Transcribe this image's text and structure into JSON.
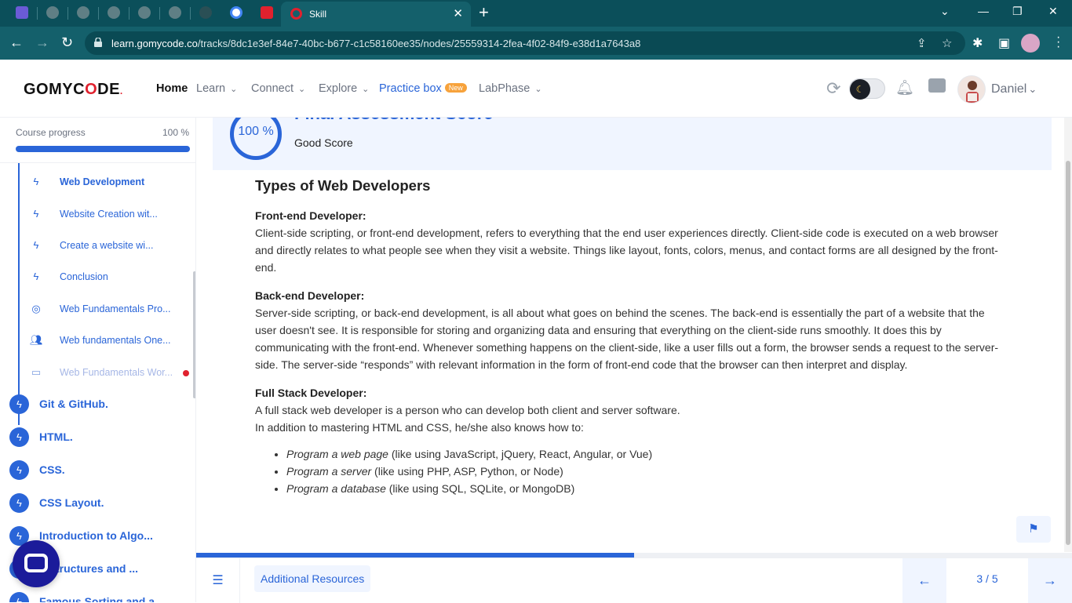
{
  "browser": {
    "active_tab_title": "Skill",
    "url_domain": "learn.gomycode.co",
    "url_path": "/tracks/8dc1e3ef-84e7-40bc-b677-c1c58160ee35/nodes/25559314-2fea-4f02-84f9-e38d1a7643a8",
    "new_tab_label": "+"
  },
  "header": {
    "logo_prefix": "GOMYC",
    "logo_o": "O",
    "logo_suffix": "DE",
    "logo_dot": ".",
    "nav": {
      "home": "Home",
      "learn": "Learn",
      "connect": "Connect",
      "explore": "Explore",
      "practice": "Practice box",
      "practice_badge": "New",
      "labphase": "LabPhase"
    },
    "user_name": "Daniel"
  },
  "sidebar": {
    "progress_label": "Course progress",
    "progress_value": "100 %",
    "progress_fraction": 1.0,
    "sub_items": [
      {
        "label": "Web Development",
        "icon": "bolt-icon"
      },
      {
        "label": "Website Creation wit...",
        "icon": "bolt-icon"
      },
      {
        "label": "Create a website wi...",
        "icon": "bolt-icon"
      },
      {
        "label": "Conclusion",
        "icon": "bolt-icon"
      },
      {
        "label": "Web Fundamentals Pro...",
        "icon": "target-icon"
      },
      {
        "label": "Web fundamentals One...",
        "icon": "people-icon"
      },
      {
        "label": "Web Fundamentals Wor...",
        "icon": "workshop-icon"
      }
    ],
    "modules": [
      {
        "label": "Git & GitHub."
      },
      {
        "label": "HTML."
      },
      {
        "label": "CSS."
      },
      {
        "label": "CSS Layout."
      },
      {
        "label": "Introduction to Algo..."
      },
      {
        "label": "a Structures and ..."
      },
      {
        "label": "Famous Sorting and a..."
      }
    ]
  },
  "score": {
    "percent": "100 %",
    "title": "Final Assessment Score",
    "subtitle": "Good Score"
  },
  "article": {
    "heading": "Types of Web Developers",
    "frontend_title": "Front-end Developer:",
    "frontend_text": "Client-side scripting, or front-end development, refers to everything that the end user experiences directly. Client-side code is executed on a web browser and directly relates to what people see when they visit a website. Things like layout, fonts, colors, menus, and contact forms are all designed by the front-end.",
    "backend_title": "Back-end Developer:",
    "backend_text": "Server-side scripting, or back-end development, is all about what goes on behind the scenes. The back-end is essentially the part of a website that the user doesn't see. It is responsible for storing and organizing data and ensuring that everything on the client-side runs smoothly. It does this by communicating with the front-end. Whenever something happens on the client-side, like a user fills out a form, the browser sends a request to the server-side. The server-side “responds” with relevant information in the form of front-end code that the browser can then interpret and display.",
    "fullstack_title": "Full Stack Developer:",
    "fullstack_text1": "A full stack web developer is a person who can develop both client and server software.",
    "fullstack_text2": "In addition to mastering HTML and CSS, he/she also knows how to:",
    "list": [
      {
        "em": "Program a web page",
        "rest": " (like using JavaScript, jQuery, React, Angular, or Vue)"
      },
      {
        "em": "Program a server",
        "rest": " (like using PHP, ASP, Python, or Node)"
      },
      {
        "em": "Program a database",
        "rest": " (like using SQL, SQLite, or MongoDB)"
      }
    ]
  },
  "footer": {
    "resources_label": "Additional Resources",
    "page_indicator": "3 / 5",
    "lesson_progress_fraction": 0.5
  },
  "colors": {
    "accent": "#2a65d8",
    "browser_chrome": "#14606b",
    "alert_dot": "#e0212e",
    "badge": "#f7a23b"
  }
}
